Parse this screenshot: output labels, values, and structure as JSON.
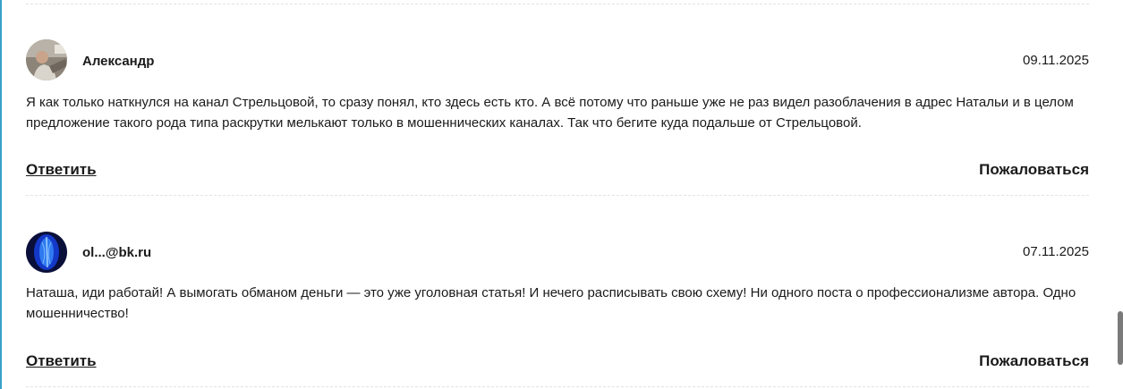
{
  "comments": [
    {
      "author": "Александр",
      "date": "09.11.2025",
      "text": "Я как только наткнулся на канал Стрельцовой, то сразу понял, кто здесь есть кто. А всё потому что раньше уже не раз видел разоблачения в адрес Натальи и в целом предложение такого рода типа раскрутки мелькают только в мошеннических каналах. Так что бегите куда подальше от Стрельцовой.",
      "reply_label": "Ответить",
      "report_label": "Пожаловаться"
    },
    {
      "author": "ol...@bk.ru",
      "date": "07.11.2025",
      "text": "Наташа, иди работай! А вымогать обманом деньги — это уже уголовная статья! И нечего расписывать свою схему! Ни одного поста о профессионализме автора. Одно мошенничество!",
      "reply_label": "Ответить",
      "report_label": "Пожаловаться"
    }
  ]
}
